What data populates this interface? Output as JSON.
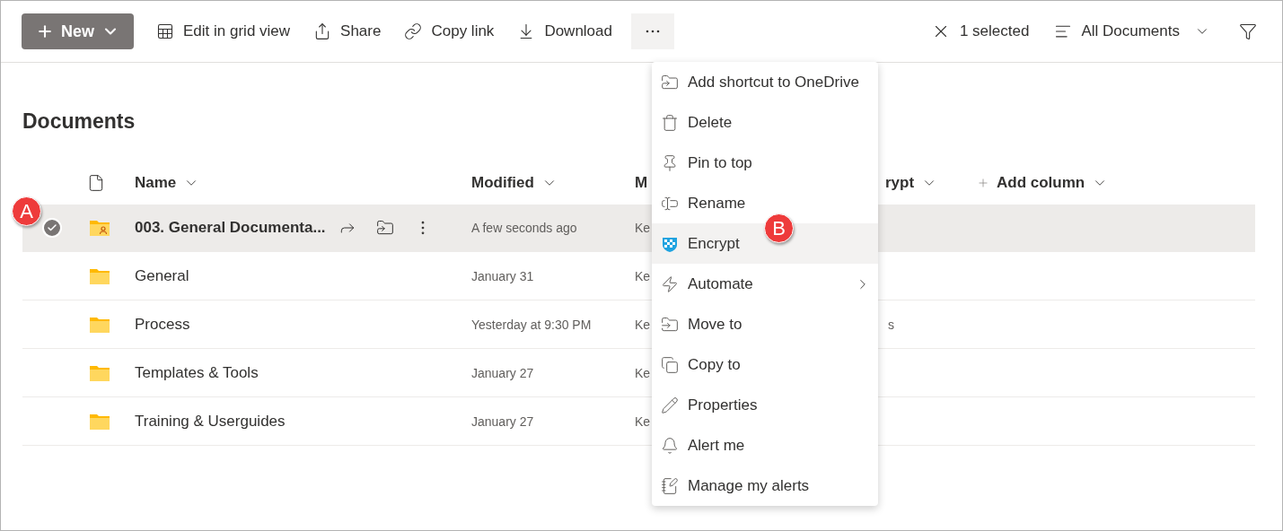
{
  "toolbar": {
    "new_button": {
      "label": "New"
    },
    "actions": [
      {
        "label": "Edit in grid view",
        "kind": "grid"
      },
      {
        "label": "Share",
        "kind": "share"
      },
      {
        "label": "Copy link",
        "kind": "link"
      },
      {
        "label": "Download",
        "kind": "download"
      }
    ],
    "more_button": {
      "selected": true
    },
    "selection": {
      "label": "1 selected"
    },
    "view": {
      "label": "All Documents"
    }
  },
  "title": "Documents",
  "table": {
    "columns": [
      {
        "kind": "type_icon"
      },
      {
        "label": "Name",
        "kind": "sortable"
      },
      {
        "label": "Modified",
        "kind": "sortable"
      },
      {
        "label": "M",
        "kind": "plain"
      },
      {
        "label": "rypt",
        "kind": "sortable"
      },
      {
        "label": "Add column",
        "kind": "add"
      }
    ],
    "rows": [
      {
        "name": "003. General Documenta...",
        "modified": "A few seconds ago",
        "column_4": "Ke",
        "selected": true,
        "kind": "shared_folder"
      },
      {
        "name": "General",
        "modified": "January 31",
        "column_4": "Ke",
        "selected": false,
        "kind": "folder"
      },
      {
        "name": "Process",
        "modified": "Yesterday at 9:30 PM",
        "column_4": "Ke",
        "column_5": "s",
        "selected": false,
        "kind": "folder"
      },
      {
        "name": "Templates & Tools",
        "modified": "January 27",
        "column_4": "Ke",
        "selected": false,
        "kind": "folder"
      },
      {
        "name": "Training & Userguides",
        "modified": "January 27",
        "column_4": "Ke",
        "selected": false,
        "kind": "folder"
      }
    ]
  },
  "menu": {
    "items": [
      {
        "label": "Add shortcut to OneDrive",
        "kind": "shortcut",
        "selected": false
      },
      {
        "label": "Delete",
        "kind": "delete",
        "selected": false
      },
      {
        "label": "Pin to top",
        "kind": "pin",
        "selected": false
      },
      {
        "label": "Rename",
        "kind": "rename",
        "selected": false
      },
      {
        "label": "Encrypt",
        "kind": "encrypt",
        "selected": true
      },
      {
        "label": "Automate",
        "kind": "automate",
        "selected": false,
        "submenu": true
      },
      {
        "label": "Move to",
        "kind": "move",
        "selected": false
      },
      {
        "label": "Copy to",
        "kind": "copy",
        "selected": false
      },
      {
        "label": "Properties",
        "kind": "properties",
        "selected": false
      },
      {
        "label": "Alert me",
        "kind": "alert",
        "selected": false
      },
      {
        "label": "Manage my alerts",
        "kind": "manage_alerts",
        "selected": false
      }
    ]
  },
  "callouts": [
    {
      "label": "A"
    },
    {
      "label": "B"
    }
  ]
}
